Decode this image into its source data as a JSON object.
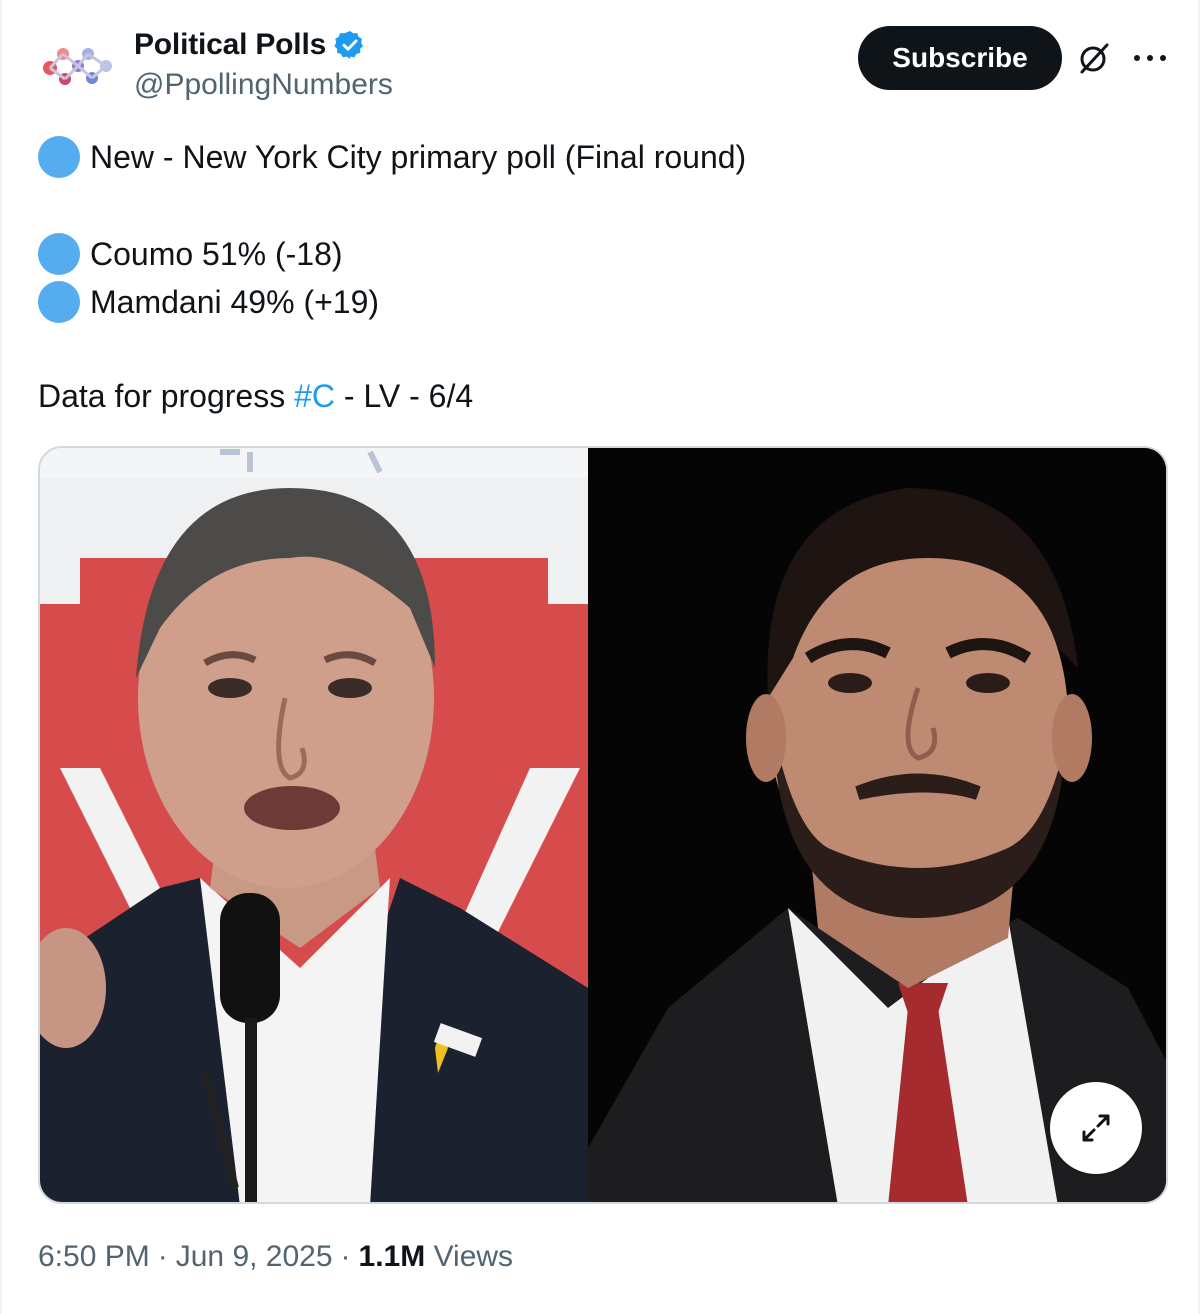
{
  "author": {
    "display_name": "Political Polls",
    "handle": "@PpollingNumbers",
    "verified_icon": "verified-badge-icon",
    "avatar_icon": "political-polls-logo"
  },
  "actions": {
    "subscribe_label": "Subscribe",
    "grok_icon": "grok-icon",
    "more_icon": "more-icon"
  },
  "tweet": {
    "line1": "New - New York City primary poll (Final round)",
    "line2": "Coumo 51% (-18)",
    "line3": "Mamdani 49% (+19)",
    "line4_prefix": "Data for progress ",
    "line4_hashtag": "#C",
    "line4_suffix": " - LV - 6/4",
    "bullet_color": "#55acee",
    "hashtag_color": "#1d9bf0"
  },
  "media": {
    "expand_icon": "expand-icon"
  },
  "footer": {
    "time": "6:50 PM",
    "sep1": "·",
    "date": "Jun 9, 2025",
    "sep2": "·",
    "views_count": "1.1M",
    "views_label": "Views"
  }
}
